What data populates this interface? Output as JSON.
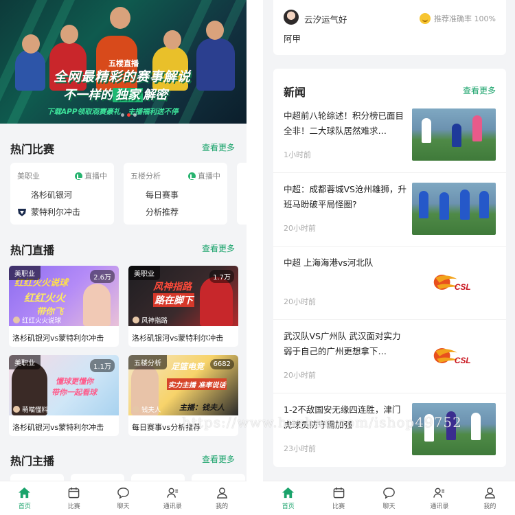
{
  "left": {
    "banner": {
      "live_tag": "五楼直播",
      "slogan_line1": "全网最精彩的赛事解说",
      "slogan_line2_pre": "不一样的",
      "slogan_line2_hl": "独家",
      "slogan_line2_post": "解密",
      "sub_text": "下载APP领取观赛豪礼　主播福利送不停"
    },
    "hot_matches": {
      "title": "热门比赛",
      "more": "查看更多",
      "cards": [
        {
          "league": "美职业",
          "status": "直播中",
          "team1": "洛杉矶银河",
          "team2": "蒙特利尔冲击"
        },
        {
          "league": "五楼分析",
          "status": "直播中",
          "team1": "每日赛事",
          "team2": "分析推荐"
        }
      ]
    },
    "hot_live": {
      "title": "热门直播",
      "more": "查看更多",
      "cards": [
        {
          "category": "美职业",
          "views": "2.6万",
          "anchor": "红红火火说球",
          "thumb_line1": "红红火火说球",
          "thumb_line2": "红红火火",
          "thumb_line3": "带你飞",
          "caption": "洛杉矶银河vs蒙特利尔冲击"
        },
        {
          "category": "美职业",
          "views": "1.7万",
          "anchor": "风神指路",
          "thumb_line1": "风神指路",
          "thumb_line2": "路在脚下",
          "thumb_line3": "",
          "caption": "洛杉矶银河vs蒙特利尔冲击"
        },
        {
          "category": "美职业",
          "views": "1.1万",
          "anchor": "萌喵懂料",
          "thumb_line1": "懂球更懂你",
          "thumb_line2": "带你一起看球",
          "thumb_line3": "",
          "caption": "洛杉矶银河vs蒙特利尔冲击"
        },
        {
          "category": "五楼分析",
          "views": "6682",
          "anchor": "钱夫人",
          "thumb_line1": "足篮电竞",
          "thumb_line2": "实力主播 准率说话",
          "thumb_line3": "主播：钱夫人",
          "caption": "每日赛事vs分析推荐"
        }
      ]
    },
    "hot_streamers": {
      "title": "热门主播",
      "more": "查看更多"
    }
  },
  "right": {
    "comment": {
      "user": "云汐运气好",
      "accuracy": "推荐准确率 100%",
      "text": "阿甲"
    },
    "news": {
      "title": "新闻",
      "more": "查看更多",
      "items": [
        {
          "headline": "中超前八轮综述！积分榜已面目全非！二大球队居然难求…",
          "time": "1小时前"
        },
        {
          "headline": "中超：成都蓉城VS沧州雄狮，升班马盼破平局怪圈?",
          "time": "20小时前"
        },
        {
          "headline": "中超 上海海港vs河北队",
          "time": "20小时前"
        },
        {
          "headline": "武汉队VS广州队 武汉面对实力弱于自己的广州更想拿下…",
          "time": "20小时前"
        },
        {
          "headline": "1-2不敌国安无缘四连胜，津门虎球员防守需加强",
          "time": "23小时前"
        }
      ],
      "csl_logo_text": "CSL"
    }
  },
  "tabbar": {
    "tabs": [
      {
        "label": "首页",
        "icon": "home-icon"
      },
      {
        "label": "比赛",
        "icon": "calendar-icon"
      },
      {
        "label": "聊天",
        "icon": "chat-bubble-icon"
      },
      {
        "label": "通讯录",
        "icon": "contacts-icon"
      },
      {
        "label": "我的",
        "icon": "user-icon"
      }
    ],
    "active_index": 0
  },
  "watermark": "https://www.huzhan.com/ishop49752",
  "colors": {
    "accent": "#1aa36b",
    "background": "#f3f4f6",
    "live_dot": "#27b36f"
  }
}
